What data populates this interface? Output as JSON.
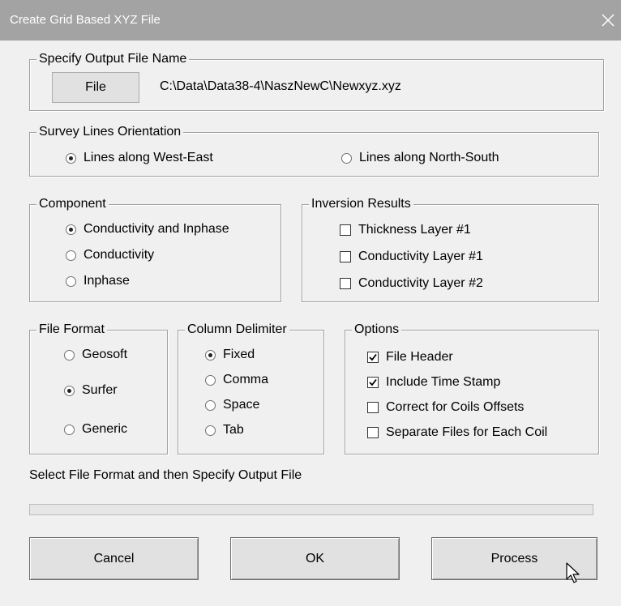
{
  "window": {
    "title": "Create Grid Based XYZ File",
    "close_glyph": "✕"
  },
  "output": {
    "legend": "Specify Output File Name",
    "file_button": "File",
    "path": "C:\\Data\\Data38-4\\NaszNewC\\Newxyz.xyz"
  },
  "orientation": {
    "legend": "Survey Lines Orientation",
    "options": [
      {
        "label": "Lines along West-East",
        "selected": true
      },
      {
        "label": "Lines along North-South",
        "selected": false
      }
    ]
  },
  "component": {
    "legend": "Component",
    "options": [
      {
        "label": "Conductivity and Inphase",
        "selected": true
      },
      {
        "label": "Conductivity",
        "selected": false
      },
      {
        "label": "Inphase",
        "selected": false
      }
    ]
  },
  "inversion": {
    "legend": "Inversion Results",
    "options": [
      {
        "label": "Thickness Layer #1",
        "checked": false
      },
      {
        "label": "Conductivity Layer #1",
        "checked": false
      },
      {
        "label": "Conductivity Layer #2",
        "checked": false
      }
    ]
  },
  "file_format": {
    "legend": "File Format",
    "options": [
      {
        "label": "Geosoft",
        "selected": false
      },
      {
        "label": "Surfer",
        "selected": true
      },
      {
        "label": "Generic",
        "selected": false
      }
    ]
  },
  "delimiter": {
    "legend": "Column Delimiter",
    "options": [
      {
        "label": "Fixed",
        "selected": true
      },
      {
        "label": "Comma",
        "selected": false
      },
      {
        "label": "Space",
        "selected": false
      },
      {
        "label": "Tab",
        "selected": false
      }
    ]
  },
  "options_group": {
    "legend": "Options",
    "options": [
      {
        "label": "File Header",
        "checked": true
      },
      {
        "label": "Include Time Stamp",
        "checked": true
      },
      {
        "label": "Correct for Coils Offsets",
        "checked": false
      },
      {
        "label": "Separate Files for Each Coil",
        "checked": false
      }
    ]
  },
  "status": {
    "text": "Select File Format and then Specify Output File",
    "progress": 0
  },
  "buttons": {
    "cancel": "Cancel",
    "ok": "OK",
    "process": "Process"
  }
}
